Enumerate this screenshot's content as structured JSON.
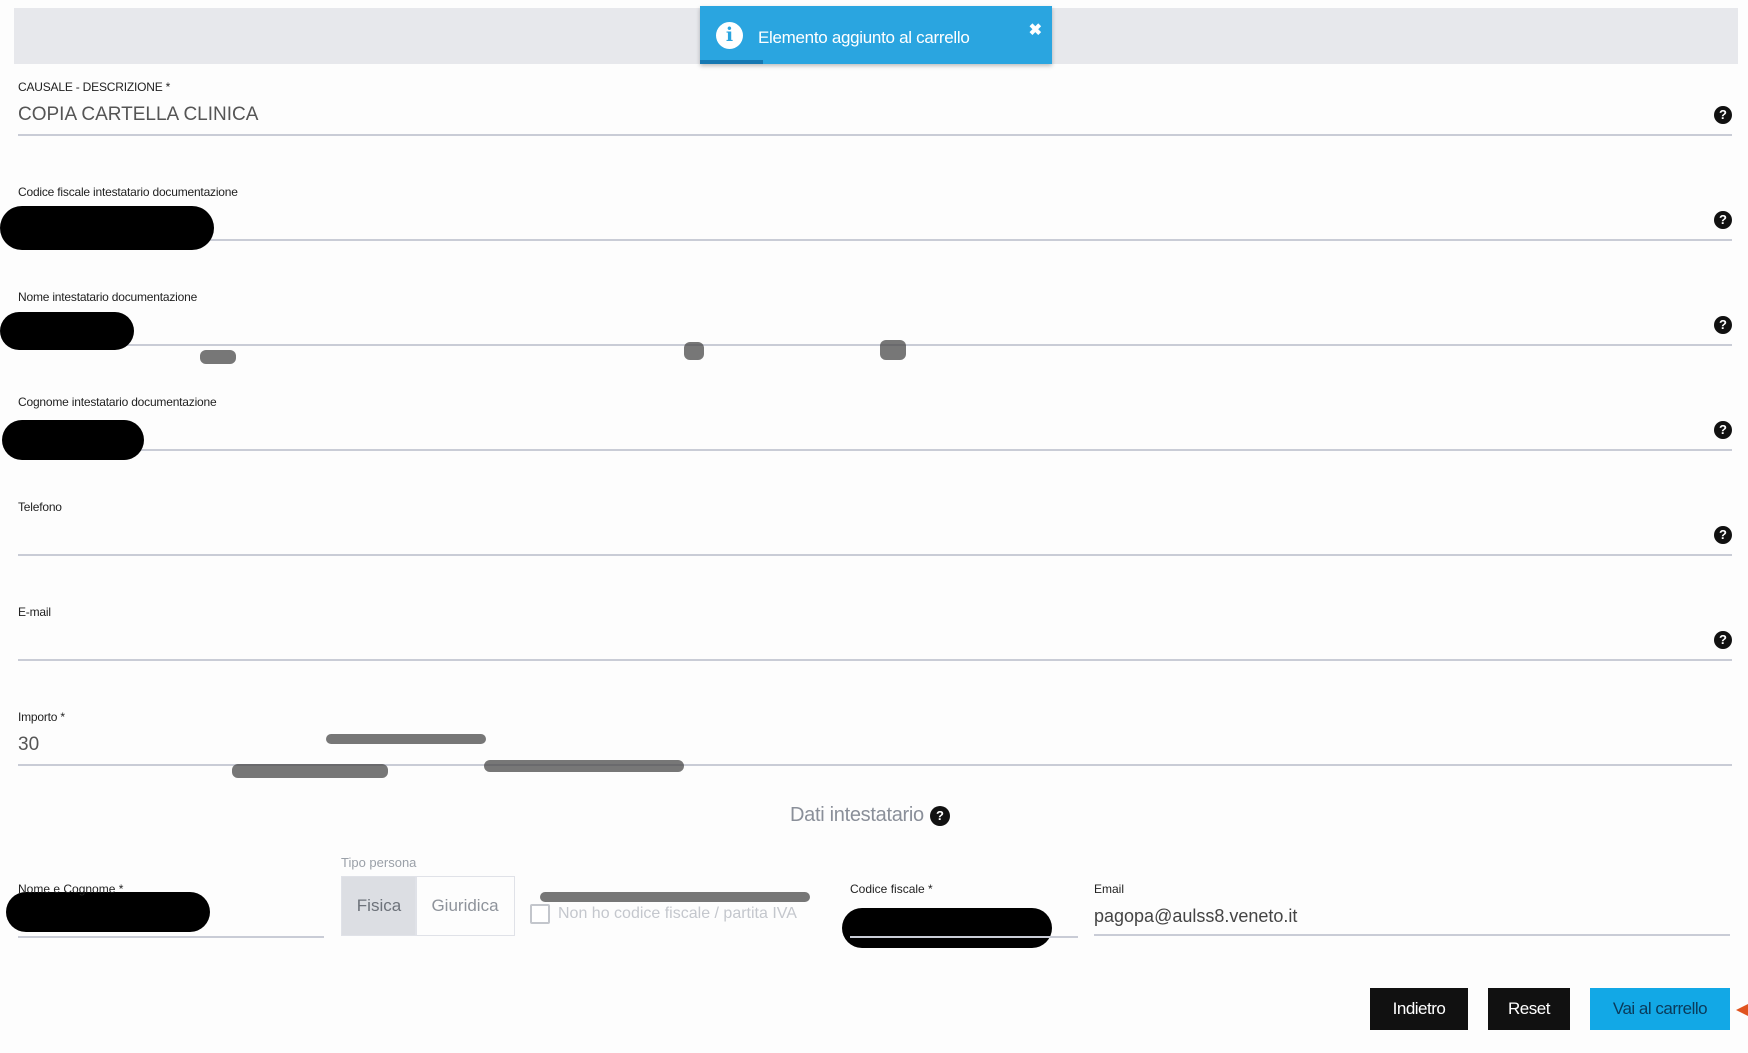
{
  "toast": {
    "message": "Elemento aggiunto al carrello",
    "close_glyph": "✖",
    "info_glyph": "i",
    "progress_fraction": 0.18
  },
  "form": {
    "fields": [
      {
        "label": "CAUSALE - DESCRIZIONE *",
        "value": "COPIA CARTELLA CLINICA"
      },
      {
        "label": "Codice fiscale intestatario documentazione",
        "value": ""
      },
      {
        "label": "Nome intestatario documentazione",
        "value": ""
      },
      {
        "label": "Cognome intestatario documentazione",
        "value": ""
      },
      {
        "label": "Telefono",
        "value": ""
      },
      {
        "label": "E-mail",
        "value": ""
      },
      {
        "label": "Importo *",
        "value": "30"
      }
    ],
    "help_glyph": "?"
  },
  "holder": {
    "section_title": "Dati intestatario",
    "name_label": "Nome e Cognome *",
    "name_value": "",
    "tipo_persona_label": "Tipo persona",
    "tipo_options": [
      "Fisica",
      "Giuridica"
    ],
    "tipo_selected": "Fisica",
    "no_cf_label": "Non ho codice fiscale / partita IVA",
    "codice_fiscale_label": "Codice fiscale *",
    "codice_fiscale_value": "",
    "email_label": "Email",
    "email_value": "pagopa@aulss8.veneto.it"
  },
  "buttons": {
    "back": "Indietro",
    "reset": "Reset",
    "cart": "Vai al carrello"
  },
  "colors": {
    "toast_bg": "#2aa5e0",
    "primary_button": "#12a8e6",
    "dark_button": "#111111",
    "underline": "#c9ccd6"
  },
  "icons": {
    "toast_icon": "info-icon",
    "toast_close": "close-icon",
    "field_help": "question-circle-icon"
  }
}
